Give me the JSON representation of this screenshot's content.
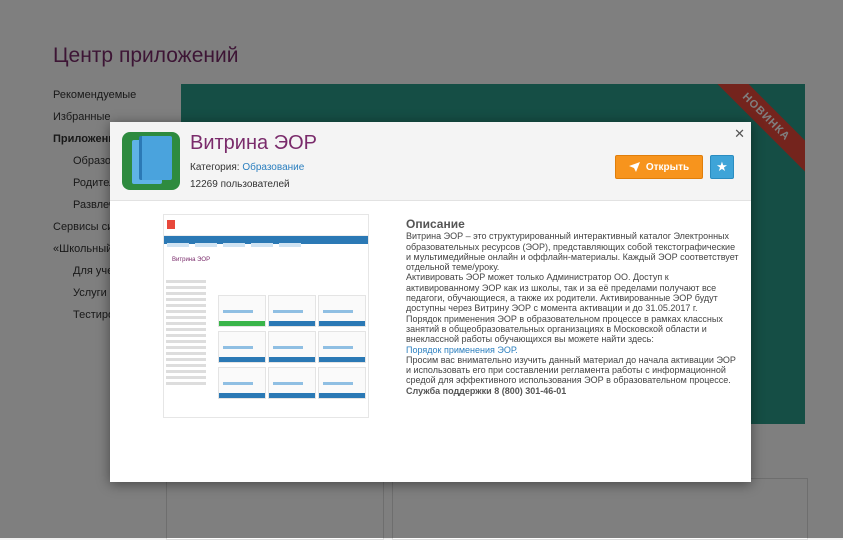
{
  "background": {
    "page_title": "Центр приложений",
    "nav": [
      {
        "label": "Рекомендуемые",
        "sub": false,
        "active": false
      },
      {
        "label": "Избранные",
        "sub": false,
        "active": false
      },
      {
        "label": "Приложения",
        "sub": false,
        "active": true
      },
      {
        "label": "Образование",
        "sub": true,
        "active": false
      },
      {
        "label": "Родителям",
        "sub": true,
        "active": false
      },
      {
        "label": "Развлечения",
        "sub": true,
        "active": false
      },
      {
        "label": "Сервисы системы",
        "sub": false,
        "active": false
      },
      {
        "label": "«Школьный портал»",
        "sub": false,
        "active": false
      },
      {
        "label": "Для учеников",
        "sub": true,
        "active": false
      },
      {
        "label": "Услуги",
        "sub": true,
        "active": false
      },
      {
        "label": "Тестирование",
        "sub": true,
        "active": false
      }
    ],
    "ribbon": "НОВИНКА"
  },
  "modal": {
    "app_title": "Витрина ЭОР",
    "category_label": "Категория:",
    "category_value": "Образование",
    "users": "12269 пользователей",
    "open_button": "Открыть",
    "star_icon": "star-icon",
    "close_icon": "close-icon",
    "description_title": "Описание",
    "description": [
      "Витрина ЭОР – это структурированный интерактивный каталог Электронных образовательных ресурсов (ЭОР), представляющих собой текстографические и мультимедийные онлайн и оффлайн-материалы. Каждый ЭОР соответствует отдельной теме/уроку.",
      "Активировать ЭОР может только Администратор ОО. Доступ к активированному ЭОР как из школы, так и за её пределами получают все педагоги, обучающиеся, а также их родители. Активированные ЭОР будут доступны через Витрину ЭОР с момента активации и до 31.05.2017 г.",
      "Порядок применения ЭОР в образовательном процессе в рамках классных занятий в общеобразовательных организациях в Московской области и внеклассной работы обучающихся вы можете найти здесь:"
    ],
    "link_text": "Порядок применения ЭОР.",
    "description_after": "Просим вас внимательно изучить данный материал до начала активации ЭОР и использовать его при составлении регламента работы с информационной средой для эффективного использования ЭОР в образовательном процессе.",
    "support": "Служба поддержки 8 (800) 301-46-01",
    "screenshot_title": "Витрина ЭОР"
  },
  "colors": {
    "accent_purple": "#7a2b6b",
    "open_button": "#f7941d",
    "star_button": "#3ea4d8",
    "link": "#2b7fbf",
    "banner": "#2a9d8a"
  }
}
